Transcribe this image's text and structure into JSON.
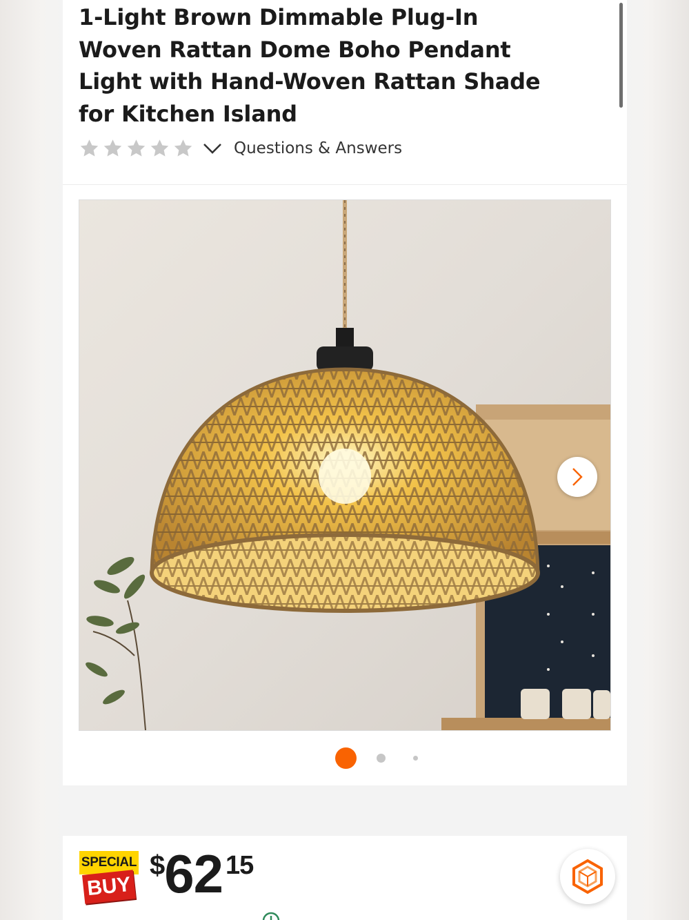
{
  "product": {
    "title": "1-Light Brown Dimmable Plug-In Woven Rattan Dome Boho Pendant Light with Hand-Woven Rattan Shade for Kitchen Island",
    "rating_stars": 5,
    "rating_filled": 0,
    "qa_label": "Questions & Answers"
  },
  "gallery": {
    "current_index": 1,
    "total_dots": 3
  },
  "badge": {
    "top": "SPECIAL",
    "bottom": "BUY"
  },
  "price": {
    "currency": "$",
    "dollars": "62",
    "cents": "15"
  },
  "colors": {
    "accent": "#f96302",
    "badge_yellow": "#ffd400",
    "badge_red": "#d8201a",
    "text": "#1b1b1b"
  },
  "icons": [
    "star-icon",
    "chevron-down-icon",
    "chevron-right-icon",
    "assistant-hexagon-icon"
  ]
}
